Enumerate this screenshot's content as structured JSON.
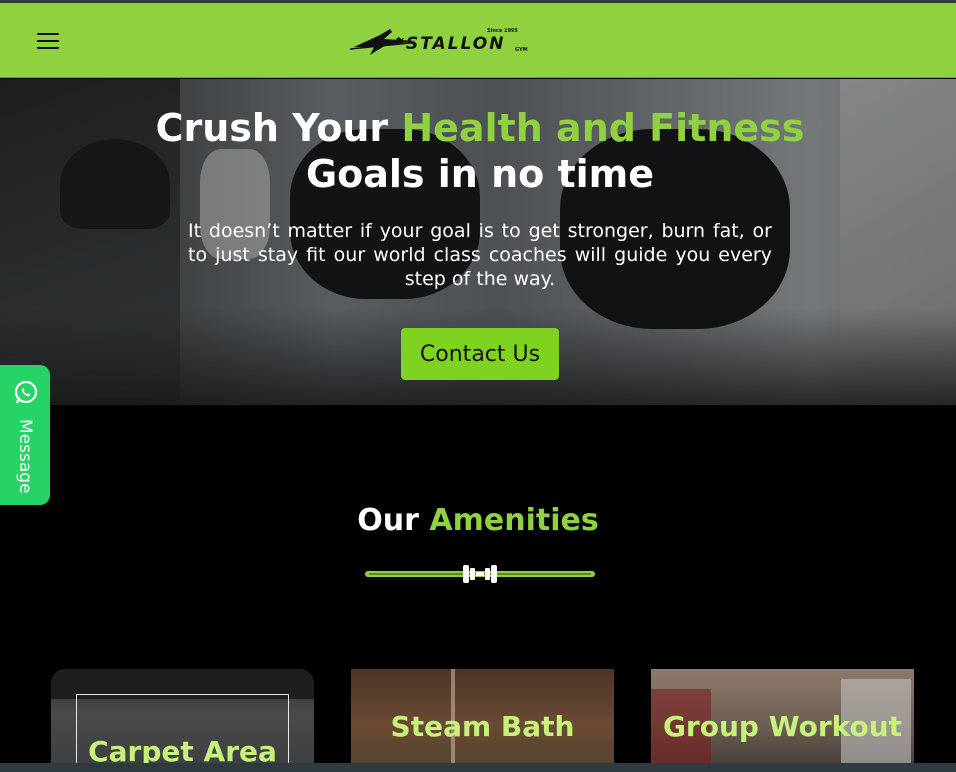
{
  "header": {
    "menu_icon": "hamburger-menu-icon",
    "logo": {
      "brand": "STALLON",
      "since": "Since 1995",
      "suffix": "GYM"
    }
  },
  "hero": {
    "title_white_1": "Crush Your ",
    "title_green": "Health and Fitness",
    "title_white_2": "Goals in no time",
    "subtitle": "It doesn’t matter if your goal is to get stronger, burn fat, or to just stay fit our world class coaches will guide you every step of the way.",
    "cta_label": "Contact Us"
  },
  "message_tab": {
    "label": "Message",
    "icon": "whatsapp-icon"
  },
  "amenities": {
    "title_white": "Our ",
    "title_green": "Amenities",
    "divider_icon": "dumbbell-icon",
    "cards": [
      {
        "title": "Carpet Area"
      },
      {
        "title": "Steam Bath"
      },
      {
        "title": "Group Workout"
      }
    ]
  },
  "colors": {
    "brand_green": "#8fd13f",
    "button_green": "#7ed321",
    "whatsapp_green": "#25d366",
    "card_title": "#c6f27a"
  }
}
